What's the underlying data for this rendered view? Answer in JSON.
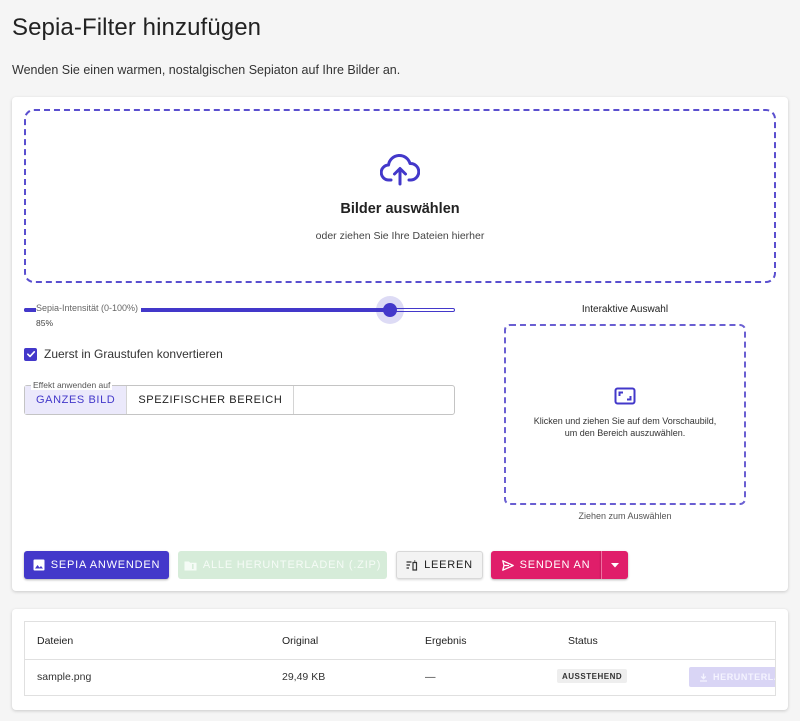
{
  "page": {
    "title": "Sepia-Filter hinzufügen",
    "subtitle": "Wenden Sie einen warmen, nostalgischen Sepiaton auf Ihre Bilder an."
  },
  "dropzone": {
    "title": "Bilder auswählen",
    "subtitle": "oder ziehen Sie Ihre Dateien hierher",
    "icon": "cloud-upload-icon"
  },
  "controls": {
    "intensity_label": "Sepia-Intensität (0-100%)",
    "intensity_value_text": "85%",
    "intensity_value": 85,
    "intensity_min": 0,
    "intensity_max": 100,
    "grayscale_label": "Zuerst in Graustufen konvertieren",
    "grayscale_checked": true,
    "apply_to_legend": "Effekt anwenden auf",
    "apply_to_options": [
      "GANZES BILD",
      "SPEZIFISCHER BEREICH"
    ],
    "apply_to_selected": "GANZES BILD"
  },
  "selection": {
    "title": "Interaktive Auswahl",
    "instruction_line1": "Klicken und ziehen Sie auf dem Vorschaubild,",
    "instruction_line2": "um den Bereich auszuwählen.",
    "hint": "Ziehen zum Auswählen",
    "icon": "crop-free-icon"
  },
  "actions": {
    "apply_label": "SEPIA ANWENDEN",
    "download_all_label": "ALLE HERUNTERLADEN (.ZIP)",
    "clear_label": "LEEREN",
    "send_label": "SENDEN AN"
  },
  "table": {
    "headers": [
      "Dateien",
      "Original",
      "Ergebnis",
      "Status"
    ],
    "rows": [
      {
        "file": "sample.png",
        "original": "29,49 KB",
        "result": "—",
        "status": "AUSSTEHEND",
        "download_label": "HERUNTERLADEN"
      }
    ]
  },
  "colors": {
    "primary": "#4338ca",
    "accent": "#e01e6a",
    "disabled_success": "#d6ecd9"
  }
}
